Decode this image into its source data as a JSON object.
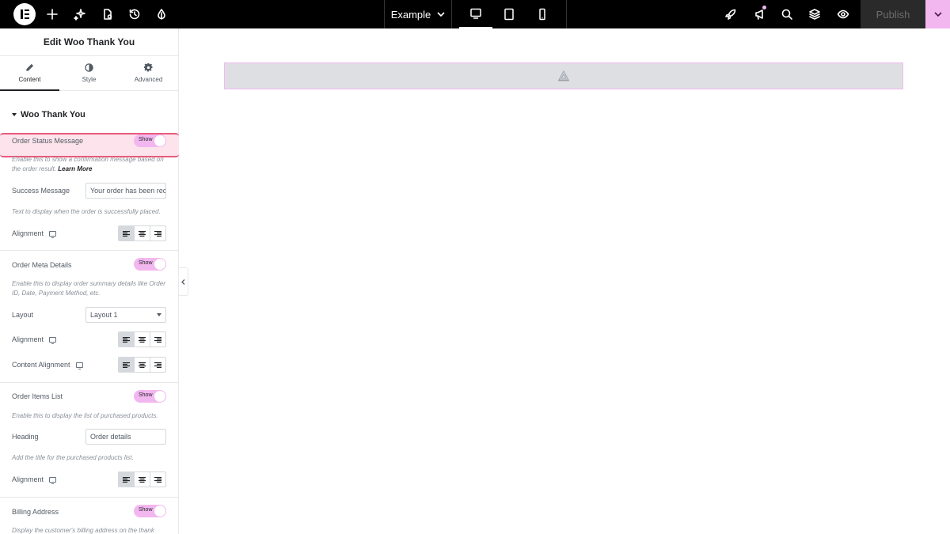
{
  "topbar": {
    "document_title": "Example",
    "publish_label": "Publish"
  },
  "panel": {
    "title": "Edit Woo Thank You",
    "tabs": [
      {
        "label": "Content",
        "icon": "pencil-icon",
        "active": true
      },
      {
        "label": "Style",
        "icon": "half-circle-icon",
        "active": false
      },
      {
        "label": "Advanced",
        "icon": "gear-icon",
        "active": false
      }
    ],
    "section_title": "Woo Thank You",
    "order_status": {
      "label": "Order Status Message",
      "toggle": "Show",
      "desc": "Enable this to show a confirmation message based on the order result.",
      "link": "Learn More"
    },
    "success_message": {
      "label": "Success Message",
      "value": "Your order has been received",
      "desc": "Text to display when the order is successfully placed."
    },
    "alignment_label": "Alignment",
    "order_meta": {
      "label": "Order Meta Details",
      "toggle": "Show",
      "desc": "Enable this to display order summary details like Order ID, Date, Payment Method, etc."
    },
    "layout": {
      "label": "Layout",
      "value": "Layout 1"
    },
    "content_alignment_label": "Content Alignment",
    "order_items": {
      "label": "Order Items List",
      "toggle": "Show",
      "desc": "Enable this to display the list of purchased products."
    },
    "heading": {
      "label": "Heading",
      "value": "Order details",
      "desc": "Add the title for the purchased products list."
    },
    "billing": {
      "label": "Billing Address",
      "toggle": "Show",
      "desc": "Display the customer's billing address on the thank"
    }
  },
  "colors": {
    "accent": "#f3b7f0",
    "highlight_border": "#e75a7c",
    "topbar": "#000000"
  }
}
